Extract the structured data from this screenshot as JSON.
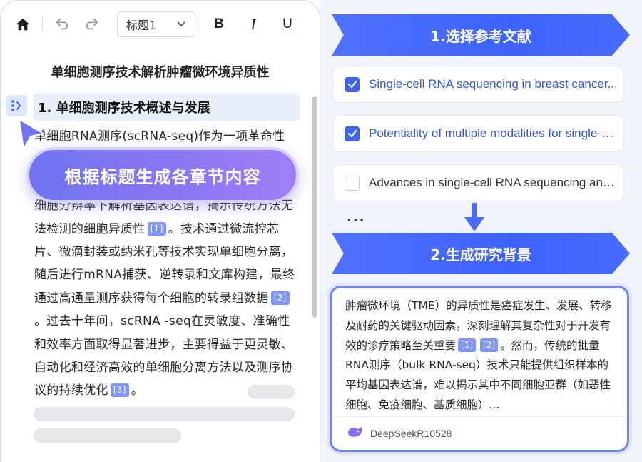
{
  "editor": {
    "heading_select": "标题1",
    "toolbar": {
      "bold": "B",
      "italic": "I",
      "underline": "U"
    },
    "doc_title": "单细胞测序技术解析肿瘤微环境异质性",
    "section_heading": "1. 单细胞测序技术概述与发展",
    "paragraph": {
      "p1": "单细胞RNA测序(scRNA-seq)作为一项革命性",
      "p2": "细胞分辨率下解析基因表达谱，揭示传统方法无法检测的细胞异质性",
      "ref1": "[1]",
      "p3": "。技术通过微流控芯片、微滴封装或纳米孔等技术实现单细胞分离，随后进行mRNA捕获、逆转录和文库构建，最终通过高通量测序获得每个细胞的转录组数据",
      "ref2": "[2]",
      "p4": "。过去十年间，scRNA -seq在灵敏度、准确性和效率方面取得显著进步，主要得益于更灵敏、自动化和经济高效的单细胞分离方法以及测序协议的持续优化",
      "ref3": "[3]",
      "p5": "。"
    },
    "generate_button": "根据标题生成各章节内容"
  },
  "workflow": {
    "step1_label": "1.选择参考文献",
    "references": [
      {
        "title": "Single-cell RNA sequencing in breast cancer...",
        "checked": true
      },
      {
        "title": "Potentiality of multiple modalities for single-cell...",
        "checked": true
      },
      {
        "title": "Advances in single-cell RNA sequencing and its...",
        "checked": false
      }
    ],
    "more": "...",
    "step2_label": "2.生成研究背景",
    "result": {
      "text_a": "肿瘤微环境（TME）的异质性是癌症发生、发展、转移及耐药的关键驱动因素，深刻理解其复杂性对于开发有效的诊疗策略至关重要",
      "ref1": "[1]",
      "ref2": "[2]",
      "text_b": "。然而，传统的批量RNA测序（bulk RNA-seq）技术只能提供组织样本的平均基因表达谱，难以揭示其中不同细胞亚群（如恶性细胞、免疫细胞、基质细胞）...",
      "model": "DeepSeekR10528"
    }
  },
  "colors": {
    "accent": "#3f63f0",
    "button_gradient_start": "#6f74f2",
    "button_gradient_end": "#a07ef5"
  }
}
